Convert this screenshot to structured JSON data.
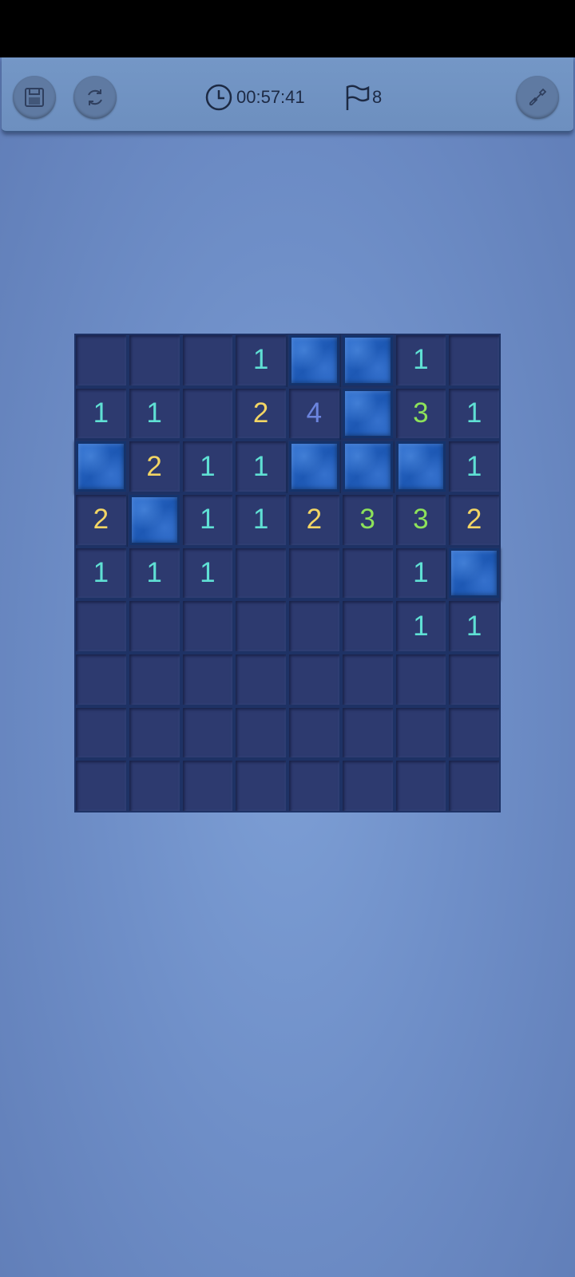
{
  "toolbar": {
    "timer": "00:57:41",
    "flags": "8",
    "icons": {
      "save": "save-icon",
      "restart": "restart-icon",
      "clock": "clock-icon",
      "flag": "flag-icon",
      "settings": "shovel-icon"
    }
  },
  "board": {
    "rows": 9,
    "cols": 8,
    "cells": [
      [
        "",
        "",
        "",
        "1",
        "#",
        "#",
        "1",
        ""
      ],
      [
        "1",
        "1",
        "",
        "2",
        "4",
        "#",
        "3",
        "1"
      ],
      [
        "#",
        "2",
        "1",
        "1",
        "#",
        "#",
        "#",
        "1"
      ],
      [
        "2",
        "#",
        "1",
        "1",
        "2",
        "3",
        "3",
        "2"
      ],
      [
        "1",
        "1",
        "1",
        "",
        "",
        "",
        "1",
        "#"
      ],
      [
        "",
        "",
        "",
        "",
        "",
        "",
        "1",
        "1"
      ],
      [
        "",
        "",
        "",
        "",
        "",
        "",
        "",
        ""
      ],
      [
        "",
        "",
        "",
        "",
        "",
        "",
        "",
        ""
      ],
      [
        "",
        "",
        "",
        "",
        "",
        "",
        "",
        ""
      ]
    ]
  },
  "colors": {
    "n1": "#5fe0d4",
    "n2": "#f2d564",
    "n3": "#8de25a",
    "n4": "#6b84de"
  }
}
